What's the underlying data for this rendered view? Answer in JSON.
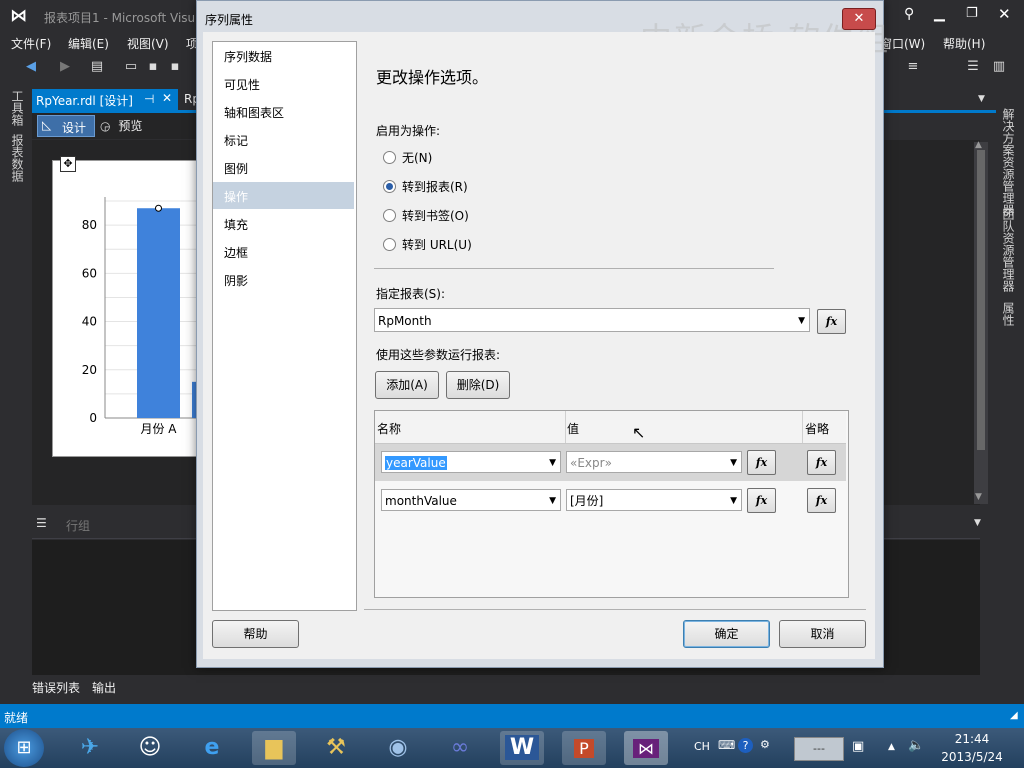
{
  "window": {
    "title": "报表项目1 - Microsoft Visu"
  },
  "menu": [
    "文件(F)",
    "编辑(E)",
    "视图(V)",
    "项",
    "窗口(W)",
    "帮助(H)"
  ],
  "left_tools": [
    "工具箱",
    "报表数据"
  ],
  "right_tools": [
    "解决方案资源管理器",
    "团队资源管理器",
    "属性"
  ],
  "doc_tabs": {
    "active": "RpYear.rdl [设计]",
    "other": "Rp"
  },
  "design_tabs": {
    "design": "设计",
    "preview": "预览"
  },
  "chart_data": {
    "type": "bar",
    "categories": [
      "月份 A",
      ""
    ],
    "values": [
      87,
      15
    ],
    "ylim": [
      0,
      90
    ],
    "yticks": [
      "0",
      "20",
      "40",
      "60",
      "80"
    ],
    "bar_color": "#3f82db"
  },
  "group_bar": {
    "label": "行组"
  },
  "bottom_tabs": [
    "错误列表",
    "输出"
  ],
  "status": "就绪",
  "dialog": {
    "title": "序列属性",
    "close": "✕",
    "nav": [
      "序列数据",
      "可见性",
      "轴和图表区",
      "标记",
      "图例",
      "操作",
      "填充",
      "边框",
      "阴影"
    ],
    "selected_nav": "操作",
    "heading": "更改操作选项。",
    "enable_label": "启用为操作:",
    "options": [
      "无(N)",
      "转到报表(R)",
      "转到书签(O)",
      "转到 URL(U)"
    ],
    "selected_option": "转到报表(R)",
    "report_label": "指定报表(S):",
    "report_value": "RpMonth",
    "params_label": "使用这些参数运行报表:",
    "add_button": "添加(A)",
    "delete_button": "删除(D)",
    "columns": [
      "名称",
      "值",
      "省略"
    ],
    "rows": [
      {
        "name": "yearValue",
        "value": "«Expr»"
      },
      {
        "name": "monthValue",
        "value": "[月份]"
      }
    ],
    "fx": "fx",
    "help_button": "帮助",
    "ok_button": "确定",
    "cancel_button": "取消"
  },
  "watermark": "中新金桥 软件组",
  "taskbar": {
    "lang": "CH",
    "time": "21:44",
    "date": "2013/5/24"
  }
}
